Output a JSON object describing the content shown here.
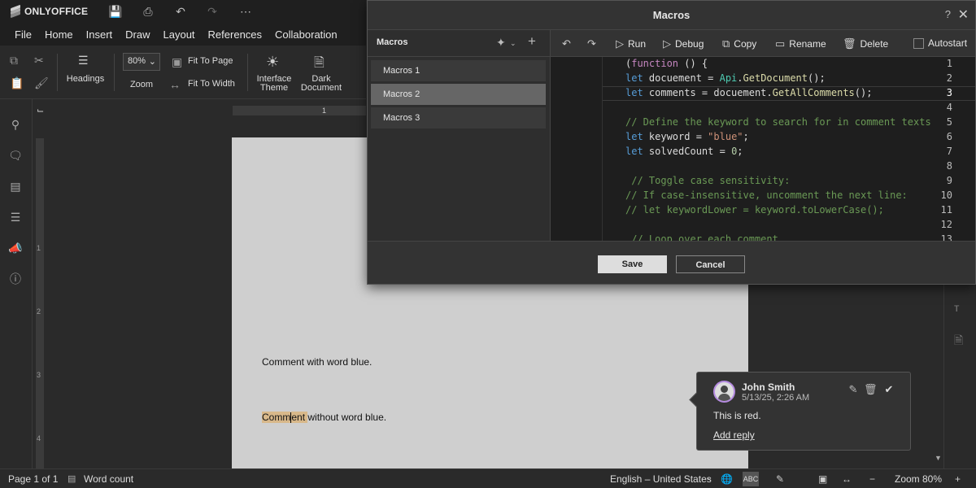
{
  "app": {
    "brand": "ONLYOFFICE",
    "title_icons": [
      "save-icon",
      "print-icon",
      "undo-icon",
      "redo-icon",
      "more-icon"
    ]
  },
  "menu": [
    "File",
    "Home",
    "Insert",
    "Draw",
    "Layout",
    "References",
    "Collaboration"
  ],
  "toolbar": {
    "headings_label": "Headings",
    "zoom_value": "80%",
    "zoom_label": "Zoom",
    "fit_page": "Fit To Page",
    "fit_width": "Fit To Width",
    "interface_theme_1": "Interface",
    "interface_theme_2": "Theme",
    "dark_doc_1": "Dark",
    "dark_doc_2": "Document"
  },
  "ruler": {
    "h_mark": "1",
    "v_marks": [
      "1",
      "2",
      "3",
      "4"
    ]
  },
  "document": {
    "line1": "Comment with word blue.",
    "line2_hl_a": "Comm",
    "line2_hl_b": "ent ",
    "line2_rest": "without word blue."
  },
  "comment": {
    "author": "John Smith",
    "date": "5/13/25, 2:26 AM",
    "text": "This is red.",
    "reply": "Add reply"
  },
  "statusbar": {
    "page": "Page 1 of 1",
    "word_count": "Word count",
    "language": "English – United States",
    "zoom": "Zoom 80%"
  },
  "dialog": {
    "title": "Macros",
    "help": "?",
    "panel_title": "Macros",
    "macros": [
      "Macros 1",
      "Macros 2",
      "Macros 3"
    ],
    "selected_index": 1,
    "actions": {
      "run": "Run",
      "debug": "Debug",
      "copy": "Copy",
      "rename": "Rename",
      "delete": "Delete",
      "autostart": "Autostart"
    },
    "save": "Save",
    "cancel": "Cancel",
    "current_line": 3,
    "code_lines": [
      "(function () {",
      "let docuement = Api.GetDocument();",
      "let comments = docuement.GetAllComments();",
      "",
      "// Define the keyword to search for in comment texts",
      "let keyword = \"blue\";",
      "let solvedCount = 0;",
      "",
      " // Toggle case sensitivity:",
      "// If case-insensitive, uncomment the next line:",
      "// let keywordLower = keyword.toLowerCase();",
      "",
      " // Loop over each comment"
    ]
  }
}
